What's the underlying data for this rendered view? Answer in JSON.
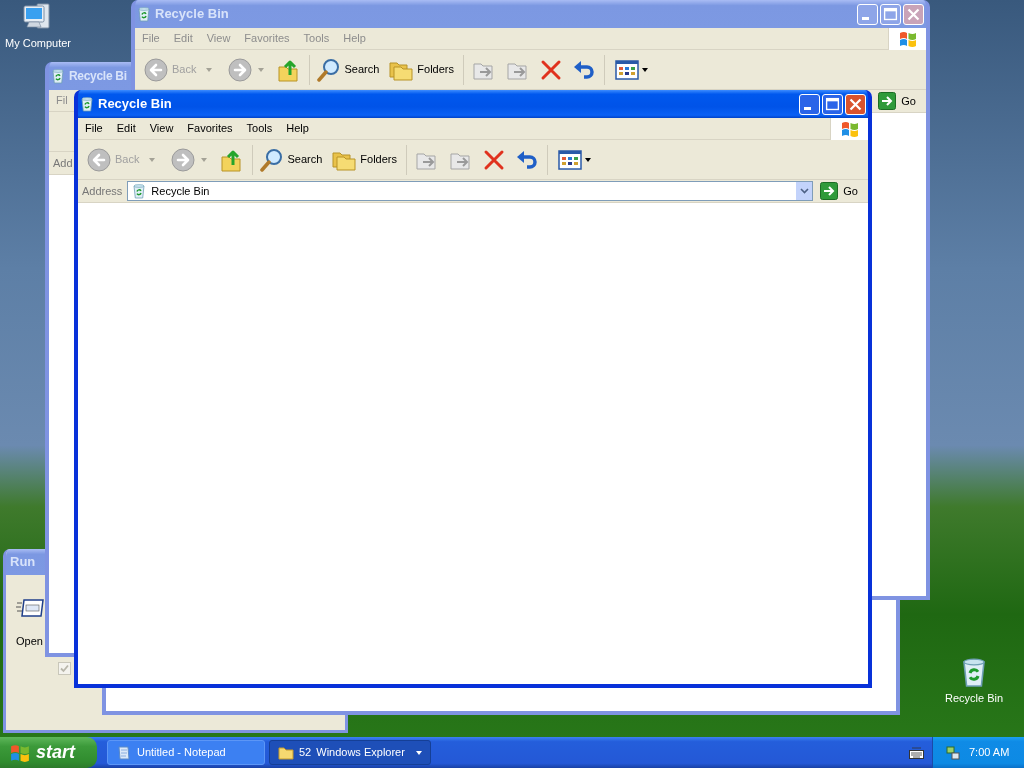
{
  "desktop_icons": [
    {
      "label": "My Computer",
      "kind": "computer"
    },
    {
      "label": "Recycle Bin",
      "kind": "recycle"
    }
  ],
  "run_dialog": {
    "title": "Run",
    "open_label": "Open",
    "option": {
      "checked": true,
      "disabled": true
    }
  },
  "windows": [
    {
      "title": "Recycle Bi",
      "active": false,
      "controls": false,
      "menu": [
        "Fil"
      ],
      "address_label": "Add"
    },
    {
      "title": "Recycle Bin",
      "active": false,
      "controls": true,
      "menu": [
        "File",
        "Edit",
        "View",
        "Favorites",
        "Tools",
        "Help"
      ],
      "toolbar": {
        "back": {
          "label": "Back",
          "disabled": true
        },
        "search": "Search",
        "folders": "Folders"
      },
      "go": "Go"
    },
    {
      "title": "Recycle Bin",
      "active": true,
      "controls": true,
      "menu": [
        "File",
        "Edit",
        "View",
        "Favorites",
        "Tools",
        "Help"
      ],
      "toolbar": {
        "back": {
          "label": "Back",
          "disabled": true
        },
        "search": "Search",
        "folders": "Folders"
      },
      "address_label": "Address",
      "address": "Recycle Bin",
      "go": "Go"
    }
  ],
  "taskbar": {
    "start": "start",
    "buttons": [
      {
        "label": "Untitled - Notepad",
        "kind": "notepad",
        "selected": false
      },
      {
        "count": "52",
        "label": "Windows Explorer",
        "kind": "group",
        "selected": true
      }
    ],
    "clock": "7:00 AM"
  }
}
